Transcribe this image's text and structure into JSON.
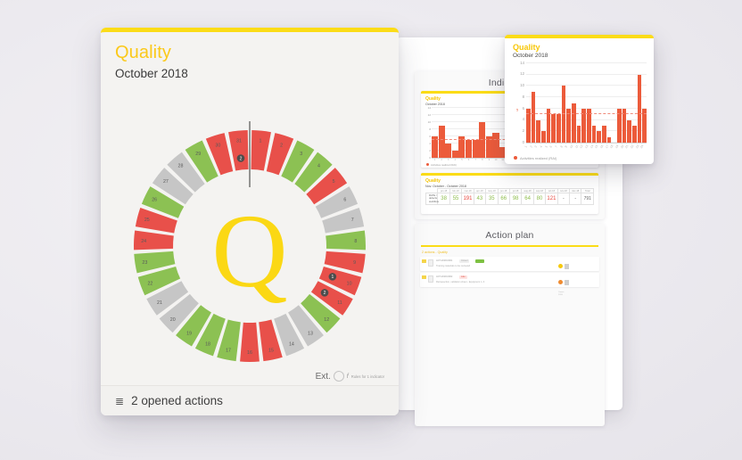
{
  "main_card": {
    "title": "Quality",
    "subtitle": "October 2018",
    "center_letter": "Q",
    "footer": {
      "icon": "list-icon",
      "text": "2 opened actions"
    },
    "legend": {
      "ext_label": "Ext.",
      "f_symbol": "f",
      "rules_text": "Rules for 1 indicator"
    },
    "donut": {
      "segments": [
        {
          "n": "1",
          "status": "red"
        },
        {
          "n": "2",
          "status": "red"
        },
        {
          "n": "3",
          "status": "green"
        },
        {
          "n": "4",
          "status": "green"
        },
        {
          "n": "5",
          "status": "red"
        },
        {
          "n": "6",
          "status": "grey"
        },
        {
          "n": "7",
          "status": "grey"
        },
        {
          "n": "8",
          "status": "green"
        },
        {
          "n": "9",
          "status": "red"
        },
        {
          "n": "10",
          "status": "red",
          "badge": "1"
        },
        {
          "n": "11",
          "status": "red",
          "badge": "2"
        },
        {
          "n": "12",
          "status": "green"
        },
        {
          "n": "13",
          "status": "grey"
        },
        {
          "n": "14",
          "status": "grey"
        },
        {
          "n": "15",
          "status": "red"
        },
        {
          "n": "16",
          "status": "red"
        },
        {
          "n": "17",
          "status": "green"
        },
        {
          "n": "18",
          "status": "green"
        },
        {
          "n": "19",
          "status": "green"
        },
        {
          "n": "20",
          "status": "grey"
        },
        {
          "n": "21",
          "status": "grey"
        },
        {
          "n": "22",
          "status": "green"
        },
        {
          "n": "23",
          "status": "green"
        },
        {
          "n": "24",
          "status": "red"
        },
        {
          "n": "25",
          "status": "red"
        },
        {
          "n": "26",
          "status": "green"
        },
        {
          "n": "27",
          "status": "grey"
        },
        {
          "n": "28",
          "status": "grey"
        },
        {
          "n": "29",
          "status": "green"
        },
        {
          "n": "30",
          "status": "red"
        },
        {
          "n": "31",
          "status": "red",
          "badge": "2"
        }
      ],
      "colors": {
        "red": "#e8504a",
        "green": "#8cc153",
        "grey": "#c6c6c6"
      }
    }
  },
  "float_card": {
    "title": "Quality",
    "subtitle": "October 2018",
    "legend_text": "Activities realized (RAI)",
    "target_label": "5"
  },
  "back_panel": {
    "indicators": {
      "title": "Indicators",
      "mini_chart": {
        "title": "Quality",
        "subtitle": "October 2018",
        "legend_text": "Activities realized (RAI)"
      },
      "mini_table": {
        "title": "Quality",
        "subtitle": "Nov. October - October 2018",
        "row_label": "RATE / defects workflow",
        "headers": [
          "jan-18",
          "feb-18",
          "mar-18",
          "apr-18",
          "may-18",
          "jun-18",
          "jul-18",
          "aug-18",
          "sep-18",
          "oct-18",
          "nov-18",
          "dec-18",
          "Total"
        ],
        "values": [
          "38",
          "55",
          "191",
          "43",
          "35",
          "66",
          "98",
          "64",
          "80",
          "121",
          "-",
          "-",
          "791"
        ],
        "value_status": [
          "green",
          "green",
          "red",
          "green",
          "green",
          "green",
          "green",
          "green",
          "green",
          "red",
          "grey",
          "grey",
          "total"
        ]
      }
    },
    "action_plan": {
      "title": "Action plan",
      "group_label": "2 actions - Quality",
      "rows": [
        {
          "ref": "ACT-2018-0001",
          "desc": "Training materials to be reviewed",
          "badge": "Closed",
          "badge_type": "grey",
          "chip": "green",
          "dot": "yellow",
          "meta1": "Owner",
          "meta2": "Priority: closed"
        },
        {
          "ref": "ACT-2018-0002",
          "desc": "Reinspection, validation sheet - Equipment n. 4",
          "badge": "Late",
          "badge_type": "red",
          "chip": "none",
          "dot": "orange",
          "meta1": "Owner",
          "meta2": "2018"
        }
      ]
    }
  },
  "chart_data": [
    {
      "type": "bar",
      "title": "Quality",
      "subtitle": "October 2018",
      "xlabel": "",
      "ylabel": "",
      "ylim": [
        0,
        14
      ],
      "yticks": [
        0,
        2,
        4,
        6,
        8,
        10,
        12,
        14
      ],
      "grid": true,
      "legend_position": "bottom-left",
      "series": [
        {
          "name": "Activities realized (RAI)",
          "values": [
            6,
            9,
            4,
            2,
            6,
            5,
            5,
            10,
            6,
            7,
            3,
            6,
            6,
            3,
            2,
            3,
            1,
            0,
            6,
            6,
            4,
            3,
            12,
            6
          ]
        }
      ],
      "categories": [
        "1",
        "2",
        "3",
        "4",
        "5",
        "6",
        "7",
        "8",
        "9",
        "10",
        "11",
        "12",
        "13",
        "14",
        "15",
        "16",
        "17",
        "18",
        "19",
        "20",
        "21",
        "22",
        "23",
        "24"
      ],
      "target_line": {
        "value": 5,
        "label": "5",
        "style": "dashed",
        "color": "#f08b7a"
      },
      "bar_color": "#ec5b3b"
    },
    {
      "type": "bar",
      "title": "Quality",
      "subtitle": "October 2018",
      "ylim": [
        0,
        14
      ],
      "yticks": [
        0,
        2,
        4,
        6,
        8,
        10,
        12,
        14
      ],
      "grid": true,
      "series": [
        {
          "name": "Activities realized (RAI)",
          "values": [
            6,
            9,
            4,
            2,
            6,
            5,
            5,
            10,
            6,
            7,
            3,
            6,
            6,
            3,
            2,
            3,
            1,
            0,
            6,
            6,
            4,
            3,
            12,
            6
          ]
        }
      ],
      "categories": [
        "1",
        "2",
        "3",
        "4",
        "5",
        "6",
        "7",
        "8",
        "9",
        "10",
        "11",
        "12",
        "13",
        "14",
        "15",
        "16",
        "17",
        "18",
        "19",
        "20",
        "21",
        "22",
        "23",
        "24"
      ],
      "target_line": {
        "value": 5,
        "style": "dashed",
        "color": "#f08b7a"
      },
      "bar_color": "#ec5b3b"
    }
  ]
}
